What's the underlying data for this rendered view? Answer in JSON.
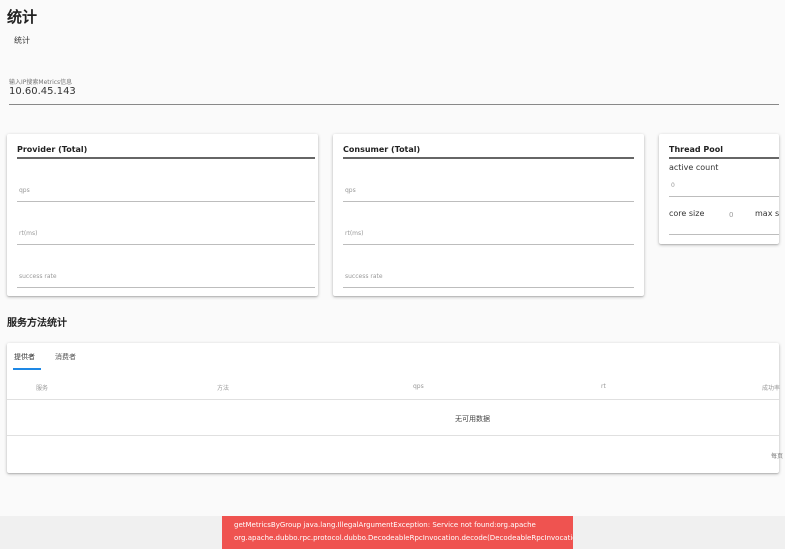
{
  "page": {
    "title": "统计",
    "breadcrumb": "统计"
  },
  "search": {
    "label": "输入IP搜索Metrics信息",
    "value": "10.60.45.143"
  },
  "provider": {
    "title": "Provider (Total)",
    "fields": [
      "qps",
      "rt(ms)",
      "success rate"
    ]
  },
  "consumer": {
    "title": "Consumer (Total)",
    "fields": [
      "qps",
      "rt(ms)",
      "success rate"
    ]
  },
  "thread_pool": {
    "title": "Thread Pool",
    "active_count_label": "active count",
    "active_count_value": "0",
    "core_size_label": "core size",
    "core_size_value": "0",
    "max_label": "max s"
  },
  "method_stats": {
    "title": "服务方法统计",
    "tabs": [
      "提供者",
      "消费者"
    ],
    "columns": [
      "服务",
      "方法",
      "qps",
      "rt",
      "成功率"
    ],
    "empty_text": "无可用数据",
    "footer_text": "每页"
  },
  "error": {
    "line1": "getMetricsByGroup java.lang.IllegalArgumentException: Service not found:org.apache",
    "line2": "org.apache.dubbo.rpc.protocol.dubbo.DecodeableRpcInvocation.decode(DecodeableRpcInvocation.java)"
  },
  "colors": {
    "tab_indicator": "#1e88e5",
    "error_bg": "#ef5350"
  }
}
